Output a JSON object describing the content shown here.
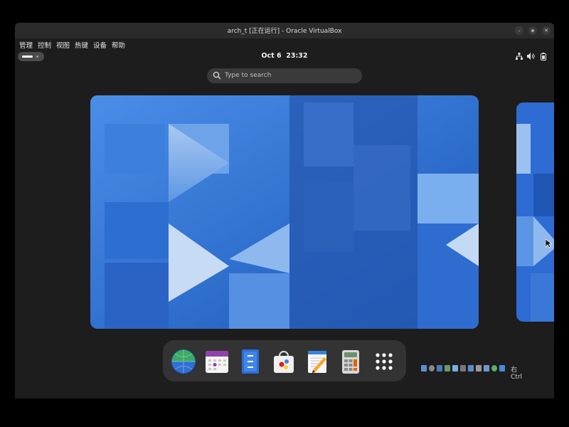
{
  "window": {
    "title": "arch_t [正在运行] - Oracle VirtualBox"
  },
  "menu": {
    "items": [
      "管理",
      "控制",
      "视图",
      "热键",
      "设备",
      "帮助"
    ]
  },
  "topbar": {
    "date": "Oct 6",
    "time": "23:32"
  },
  "search": {
    "placeholder": "Type to search"
  },
  "dock": {
    "apps": [
      "web-browser",
      "calendar",
      "files",
      "software-store",
      "text-editor",
      "calculator",
      "show-apps"
    ]
  },
  "statusbar": {
    "host_key": "右 Ctrl"
  },
  "colors": {
    "accent": "#2f6fd6",
    "background": "#1d1d1d",
    "dock": "#333333"
  }
}
